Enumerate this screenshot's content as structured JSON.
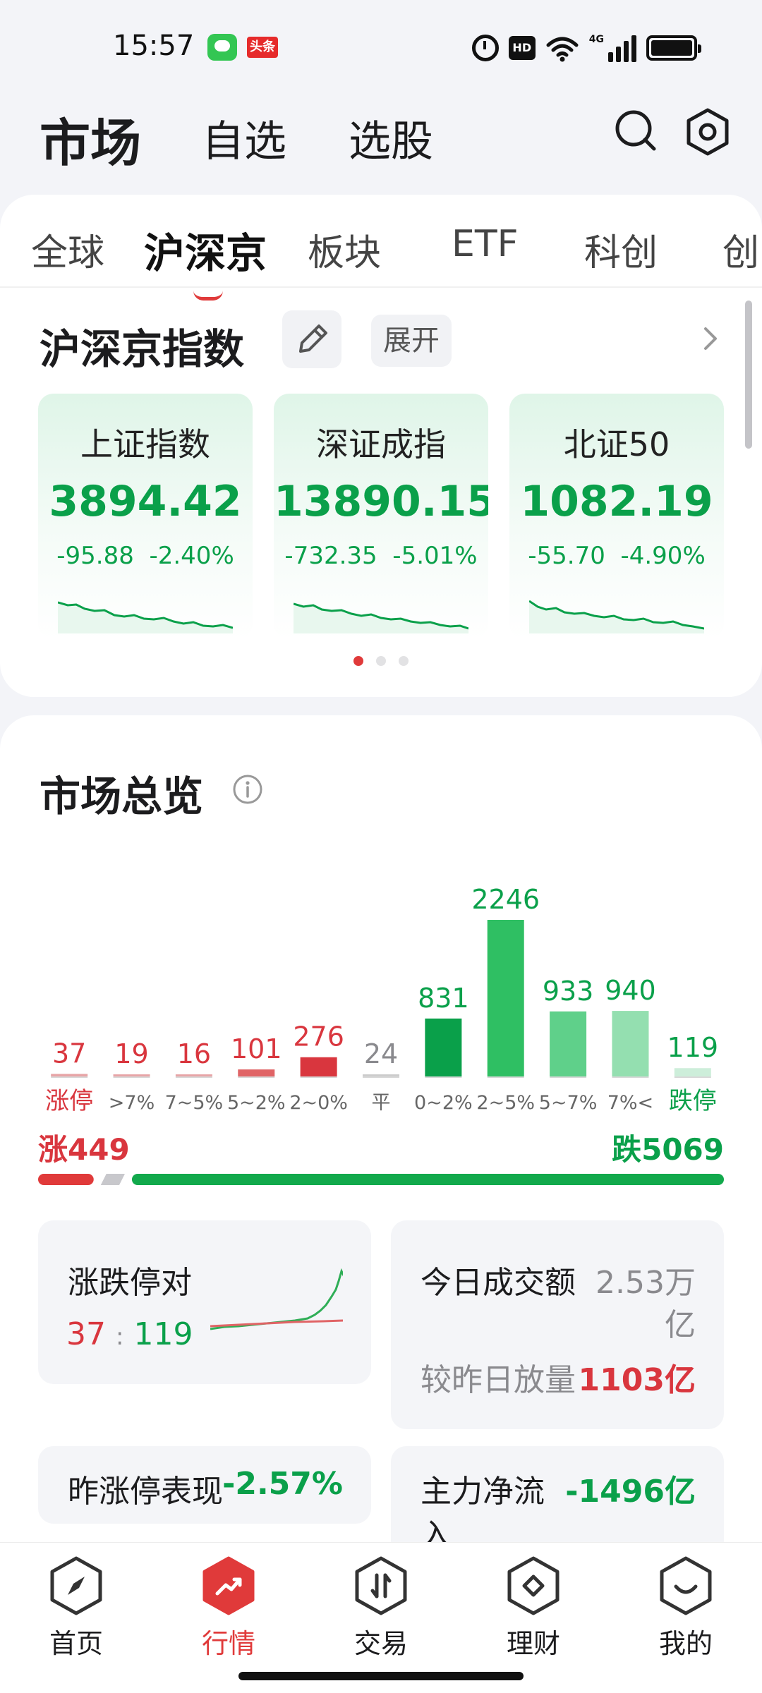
{
  "status_bar": {
    "time": "15:57",
    "toutiao_badge": "头条",
    "hd_badge": "HD",
    "network": "4G"
  },
  "header": {
    "tabs": [
      "市场",
      "自选",
      "选股"
    ],
    "active_tab": "市场"
  },
  "category_tabs": [
    "全球",
    "沪深京",
    "板块",
    "ETF",
    "科创",
    "创"
  ],
  "active_category": "沪深京",
  "index_section": {
    "title": "沪深京指数",
    "expand_label": "展开",
    "cards": [
      {
        "name": "上证指数",
        "value": "3894.42",
        "change": "-95.88",
        "percent": "-2.40%"
      },
      {
        "name": "深证成指",
        "value": "13890.15",
        "change": "-732.35",
        "percent": "-5.01%"
      },
      {
        "name": "北证50",
        "value": "1082.19",
        "change": "-55.70",
        "percent": "-4.90%"
      }
    ],
    "page_count": 3,
    "page_active": 0
  },
  "overview": {
    "title": "市场总览",
    "rise_label": "涨449",
    "fall_label": "跌5069",
    "limit_pair": {
      "title": "涨跌停对",
      "up": "37",
      "sep": ":",
      "down": "119"
    },
    "turnover": {
      "title": "今日成交额",
      "value_line1": "2.53万",
      "value_line2": "亿",
      "compare_label": "较昨日放量",
      "compare_value": "1103亿"
    },
    "yesterday_limit": {
      "title": "昨涨停表现",
      "value": "-2.57%"
    },
    "main_flow": {
      "title_line1": "主力净流",
      "title_line2": "入",
      "value": "-1496亿"
    }
  },
  "chart_data": {
    "type": "bar",
    "categories": [
      "涨停",
      ">7%",
      "7~5%",
      "5~2%",
      "2~0%",
      "平",
      "0~2%",
      "2~5%",
      "5~7%",
      "7%<",
      "跌停"
    ],
    "values": [
      37,
      19,
      16,
      101,
      276,
      24,
      831,
      2246,
      933,
      940,
      119
    ],
    "colors": [
      "#e7a4a6",
      "#e7a4a6",
      "#e7a4a6",
      "#e06466",
      "#d9363e",
      "#cccccc",
      "#0aa04a",
      "#2fbf63",
      "#5fd08a",
      "#94dfb0",
      "#cdeeda"
    ],
    "label_colors": [
      "#d9363e",
      "#d9363e",
      "#d9363e",
      "#d9363e",
      "#d9363e",
      "#8a8a8e",
      "#0aa04a",
      "#0aa04a",
      "#0aa04a",
      "#0aa04a",
      "#0aa04a"
    ],
    "rise_total": 449,
    "fall_total": 5069,
    "ylim": [
      0,
      2246
    ]
  },
  "bottom_nav": [
    {
      "label": "首页",
      "icon": "compass-icon"
    },
    {
      "label": "行情",
      "icon": "trend-icon"
    },
    {
      "label": "交易",
      "icon": "trade-icon"
    },
    {
      "label": "理财",
      "icon": "finance-icon"
    },
    {
      "label": "我的",
      "icon": "profile-icon"
    }
  ],
  "active_nav": "行情"
}
